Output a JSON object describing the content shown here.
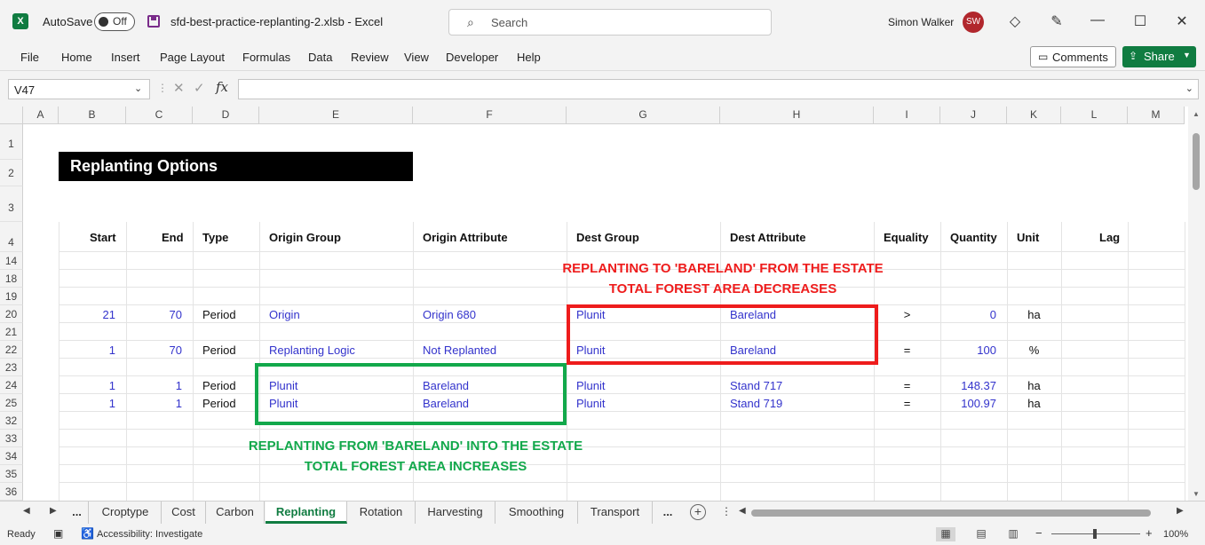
{
  "titlebar": {
    "autosave_label": "AutoSave",
    "autosave_state": "Off",
    "document_title": "sfd-best-practice-replanting-2.xlsb  -  Excel",
    "search_placeholder": "Search",
    "user_name": "Simon Walker",
    "user_initials": "SW"
  },
  "ribbon": {
    "tabs": [
      "File",
      "Home",
      "Insert",
      "Page Layout",
      "Formulas",
      "Data",
      "Review",
      "View",
      "Developer",
      "Help"
    ],
    "comments_label": "Comments",
    "share_label": "Share"
  },
  "formula_bar": {
    "name_box": "V47",
    "formula": ""
  },
  "grid": {
    "columns": [
      "A",
      "B",
      "C",
      "D",
      "E",
      "F",
      "G",
      "H",
      "I",
      "J",
      "K",
      "L",
      "M"
    ],
    "rows": [
      "1",
      "2",
      "3",
      "4",
      "14",
      "18",
      "19",
      "20",
      "21",
      "22",
      "23",
      "24",
      "25",
      "32",
      "33",
      "34",
      "35",
      "36"
    ],
    "title": "Replanting Options",
    "headers": {
      "start": "Start",
      "end": "End",
      "type": "Type",
      "origin_group": "Origin Group",
      "origin_attribute": "Origin Attribute",
      "dest_group": "Dest Group",
      "dest_attribute": "Dest Attribute",
      "equality": "Equality",
      "quantity": "Quantity",
      "unit": "Unit",
      "lag": "Lag"
    },
    "data_rows": {
      "r20": {
        "start": "21",
        "end": "70",
        "type": "Period",
        "origin_group": "Origin",
        "origin_attribute": "Origin 680",
        "dest_group": "Plunit",
        "dest_attribute": "Bareland",
        "equality": ">",
        "quantity": "0",
        "unit": "ha"
      },
      "r22": {
        "start": "1",
        "end": "70",
        "type": "Period",
        "origin_group": "Replanting Logic",
        "origin_attribute": "Not Replanted",
        "dest_group": "Plunit",
        "dest_attribute": "Bareland",
        "equality": "=",
        "quantity": "100",
        "unit": "%"
      },
      "r24": {
        "start": "1",
        "end": "1",
        "type": "Period",
        "origin_group": "Plunit",
        "origin_attribute": "Bareland",
        "dest_group": "Plunit",
        "dest_attribute": "Stand 717",
        "equality": "=",
        "quantity": "148.37",
        "unit": "ha"
      },
      "r25": {
        "start": "1",
        "end": "1",
        "type": "Period",
        "origin_group": "Plunit",
        "origin_attribute": "Bareland",
        "dest_group": "Plunit",
        "dest_attribute": "Stand 719",
        "equality": "=",
        "quantity": "100.97",
        "unit": "ha"
      }
    },
    "annotation_red": {
      "line1": "REPLANTING TO 'BARELAND' FROM THE ESTATE",
      "line2": "TOTAL FOREST AREA DECREASES",
      "color": "#ee1c1c"
    },
    "annotation_green": {
      "line1": "REPLANTING FROM 'BARELAND' INTO THE ESTATE",
      "line2": "TOTAL FOREST AREA INCREASES",
      "color": "#12a84b"
    }
  },
  "sheets": {
    "ellipsis": "...",
    "tabs": [
      "Croptype",
      "Cost",
      "Carbon",
      "Replanting",
      "Rotation",
      "Harvesting",
      "Smoothing",
      "Transport"
    ],
    "active": "Replanting"
  },
  "statusbar": {
    "ready": "Ready",
    "accessibility": "Accessibility: Investigate",
    "zoom": "100%"
  },
  "colors": {
    "excel_green": "#107c41",
    "cell_blue": "#3333cc"
  }
}
